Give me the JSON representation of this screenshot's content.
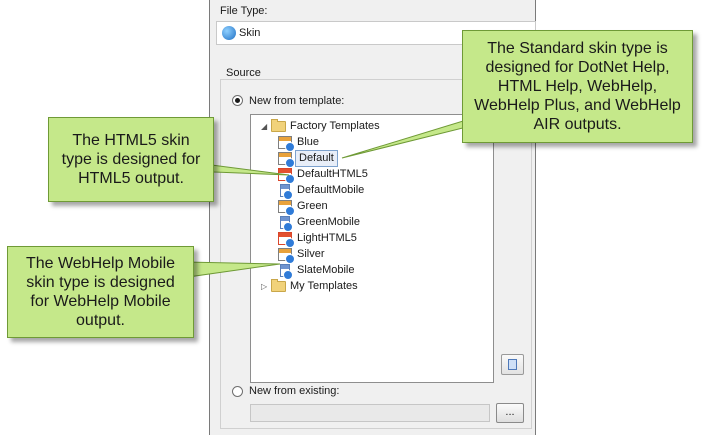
{
  "dialog": {
    "file_type_label": "File Type:",
    "file_type_value": "Skin",
    "source_label": "Source",
    "new_from_template": "New from template:",
    "new_from_existing": "New from existing:",
    "browse_label": "...",
    "tree": [
      {
        "label": "Factory Templates",
        "type": "folder",
        "expanded": true,
        "depth": 0
      },
      {
        "label": "Blue",
        "type": "standard",
        "depth": 1
      },
      {
        "label": "Default",
        "type": "standard",
        "depth": 1,
        "selected": true
      },
      {
        "label": "DefaultHTML5",
        "type": "html5",
        "depth": 1
      },
      {
        "label": "DefaultMobile",
        "type": "mobile",
        "depth": 1
      },
      {
        "label": "Green",
        "type": "standard",
        "depth": 1
      },
      {
        "label": "GreenMobile",
        "type": "mobile",
        "depth": 1
      },
      {
        "label": "LightHTML5",
        "type": "html5",
        "depth": 1
      },
      {
        "label": "Silver",
        "type": "standard",
        "depth": 1
      },
      {
        "label": "SlateMobile",
        "type": "mobile",
        "depth": 1
      },
      {
        "label": "My Templates",
        "type": "folder",
        "expanded": false,
        "depth": 0
      }
    ]
  },
  "callouts": {
    "standard": "The Standard skin type is designed for DotNet Help, HTML Help, WebHelp, WebHelp Plus, and WebHelp AIR outputs.",
    "html5": "The HTML5 skin type is designed for HTML5 output.",
    "mobile": "The WebHelp Mobile skin type is designed for WebHelp Mobile output."
  },
  "colors": {
    "callout_fill": "#c5e88a",
    "callout_border": "#6f9a36",
    "selection": "#e8eef8"
  }
}
